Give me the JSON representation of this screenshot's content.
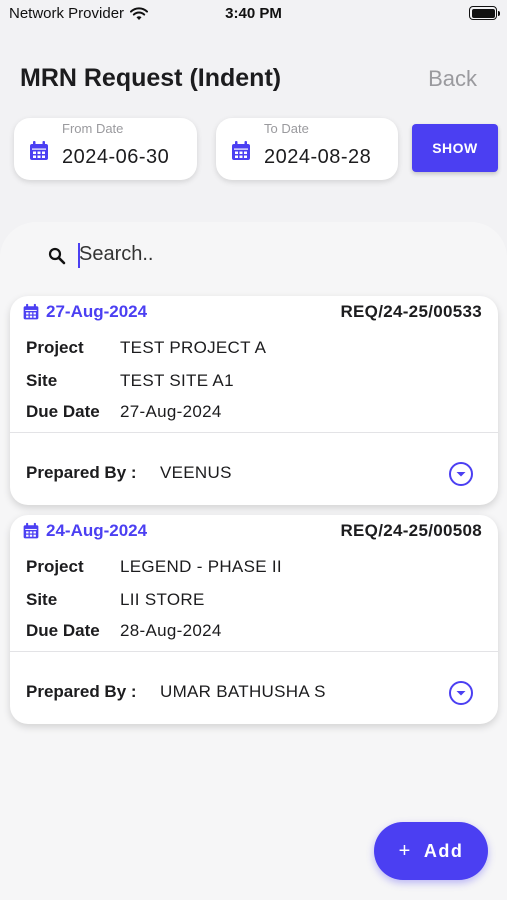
{
  "status_bar": {
    "carrier": "Network Provider",
    "time": "3:40 PM"
  },
  "header": {
    "title": "MRN Request (Indent)",
    "back_label": "Back"
  },
  "filters": {
    "from_label": "From Date",
    "from_value": "2024-06-30",
    "to_label": "To Date",
    "to_value": "2024-08-28",
    "show_label": "SHOW"
  },
  "search": {
    "placeholder": "Search.."
  },
  "requests": [
    {
      "date": "27-Aug-2024",
      "number": "REQ/24-25/00533",
      "project_label": "Project",
      "project": "TEST PROJECT A",
      "site_label": "Site",
      "site": "TEST SITE A1",
      "due_label": "Due Date",
      "due": "27-Aug-2024",
      "prepared_label": "Prepared By :",
      "prepared_by": "VEENUS"
    },
    {
      "date": "24-Aug-2024",
      "number": "REQ/24-25/00508",
      "project_label": "Project",
      "project": "LEGEND - PHASE II",
      "site_label": "Site",
      "site": "LII STORE",
      "due_label": "Due Date",
      "due": "28-Aug-2024",
      "prepared_label": "Prepared By :",
      "prepared_by": "UMAR BATHUSHA S"
    }
  ],
  "fab": {
    "label": "Add"
  },
  "colors": {
    "accent": "#4b3ff2",
    "background": "#f2f2f4",
    "muted": "#9a9a9e"
  }
}
